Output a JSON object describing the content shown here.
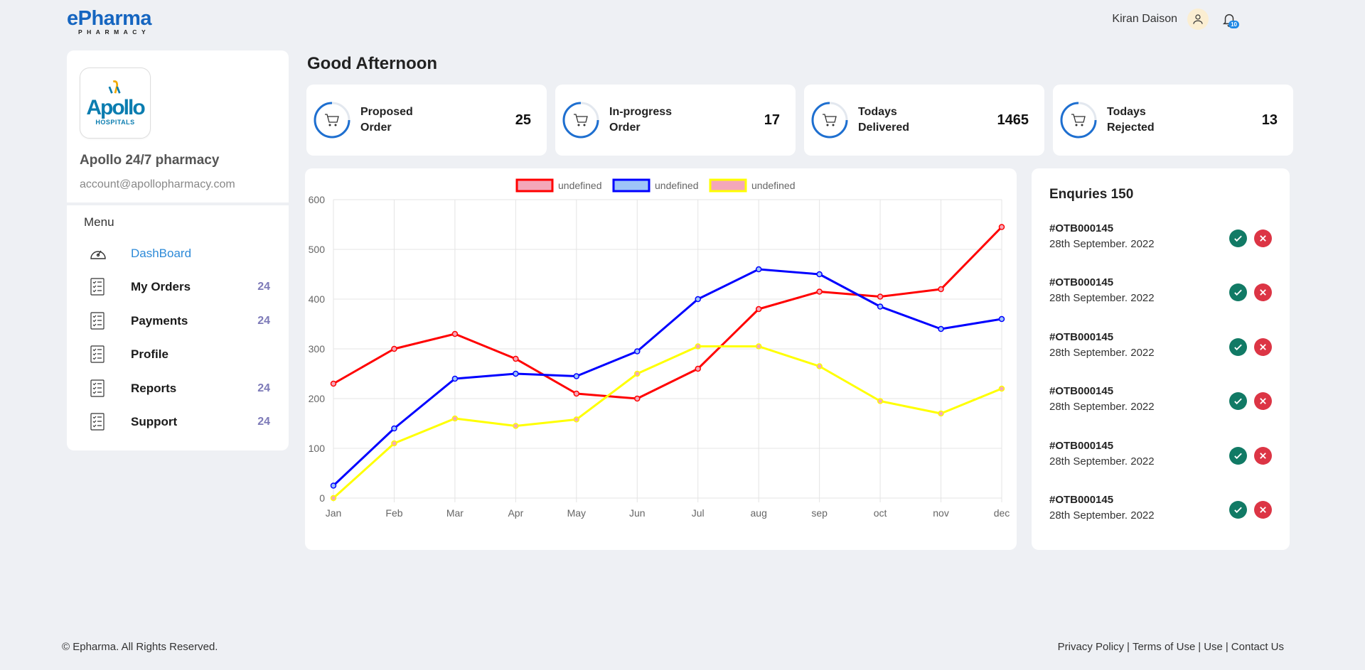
{
  "header": {
    "brand": "ePharma",
    "brand_sub": "PHARMACY",
    "user_name": "Kiran Daison",
    "notification_count": "10"
  },
  "sidebar": {
    "logo_text": "Apollo",
    "logo_sub": "HOSPITALS",
    "pharmacy_name": "Apollo 24/7 pharmacy",
    "email": "account@apollopharmacy.com",
    "menu_title": "Menu",
    "items": [
      {
        "label": "DashBoard",
        "count": "",
        "icon": "dashboard-gauge-icon",
        "active": true
      },
      {
        "label": "My Orders",
        "count": "24",
        "icon": "checklist-icon"
      },
      {
        "label": "Payments",
        "count": "24",
        "icon": "checklist-icon"
      },
      {
        "label": "Profile",
        "count": "",
        "icon": "checklist-icon"
      },
      {
        "label": "Reports",
        "count": "24",
        "icon": "checklist-icon"
      },
      {
        "label": "Support",
        "count": "24",
        "icon": "checklist-icon"
      }
    ]
  },
  "main": {
    "greeting": "Good Afternoon",
    "stats": [
      {
        "line1": "Proposed",
        "line2": "Order",
        "value": "25",
        "icon": "cart-icon"
      },
      {
        "line1": "In-progress",
        "line2": "Order",
        "value": "17",
        "icon": "cart-icon"
      },
      {
        "line1": "Todays",
        "line2": "Delivered",
        "value": "1465",
        "icon": "cart-icon"
      },
      {
        "line1": "Todays",
        "line2": "Rejected",
        "value": "13",
        "icon": "cart-icon"
      }
    ]
  },
  "chart_data": {
    "type": "line",
    "title": "",
    "xlabel": "",
    "ylabel": "",
    "ylim": [
      0,
      600
    ],
    "yticks": [
      0,
      100,
      200,
      300,
      400,
      500,
      600
    ],
    "grid": true,
    "legend_position": "top",
    "categories": [
      "Jan",
      "Feb",
      "Mar",
      "Apr",
      "May",
      "Jun",
      "Jul",
      "aug",
      "sep",
      "oct",
      "nov",
      "dec"
    ],
    "series": [
      {
        "name": "undefined",
        "color": "#ff0000",
        "fill": "#f4a7b9",
        "values": [
          230,
          300,
          330,
          280,
          210,
          200,
          260,
          380,
          415,
          405,
          420,
          545
        ]
      },
      {
        "name": "undefined",
        "color": "#0000ff",
        "fill": "#9ec5f8",
        "values": [
          25,
          140,
          240,
          250,
          245,
          295,
          400,
          460,
          450,
          385,
          340,
          360
        ]
      },
      {
        "name": "undefined",
        "color": "#ffff00",
        "fill": "#f4a7b9",
        "values": [
          0,
          110,
          160,
          145,
          158,
          250,
          305,
          305,
          265,
          195,
          170,
          220
        ]
      }
    ]
  },
  "enquiries": {
    "title": "Enquries 150",
    "items": [
      {
        "id": "#OTB000145",
        "date": "28th September. 2022"
      },
      {
        "id": "#OTB000145",
        "date": "28th September. 2022"
      },
      {
        "id": "#OTB000145",
        "date": "28th September. 2022"
      },
      {
        "id": "#OTB000145",
        "date": "28th September. 2022"
      },
      {
        "id": "#OTB000145",
        "date": "28th September. 2022"
      },
      {
        "id": "#OTB000145",
        "date": "28th September. 2022"
      }
    ]
  },
  "footer": {
    "copyright": "© Epharma. All Rights Reserved.",
    "links": [
      "Privacy Policy",
      "Terms of Use",
      "Use",
      "Contact Us"
    ]
  }
}
